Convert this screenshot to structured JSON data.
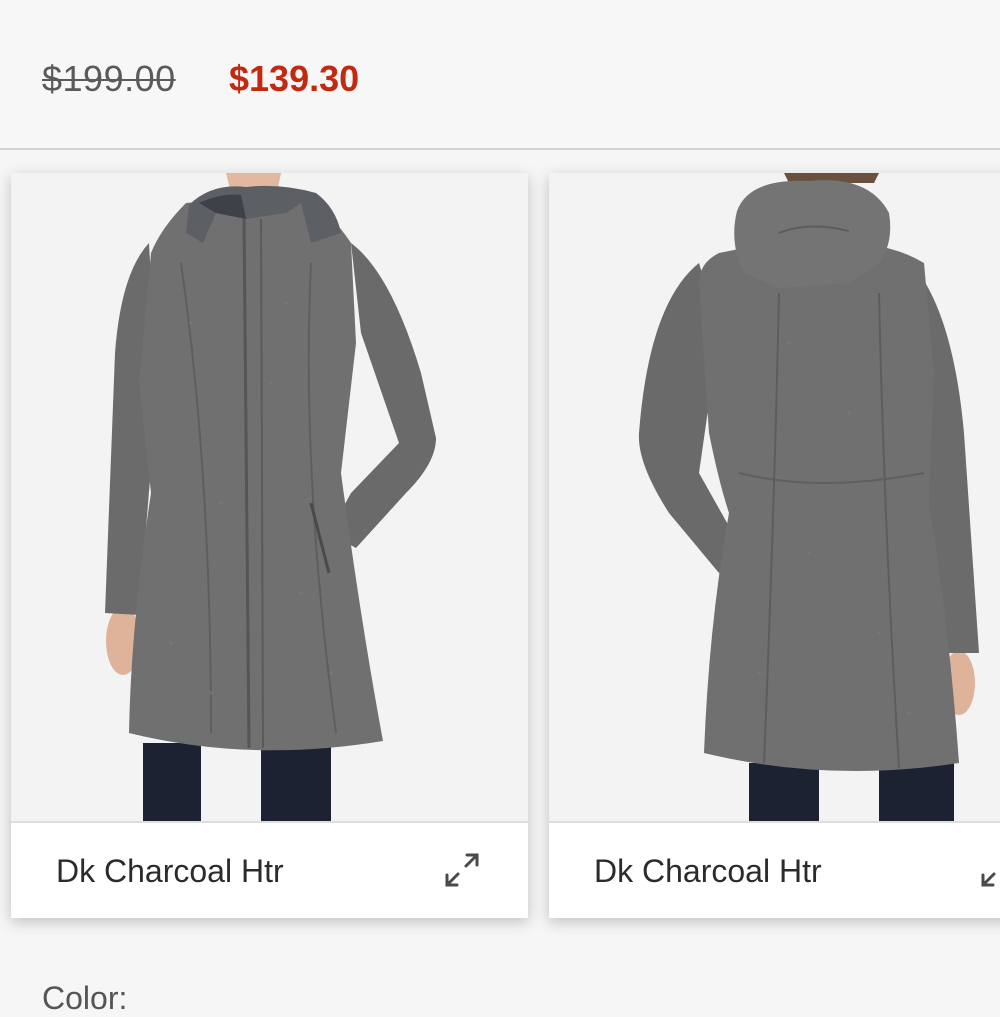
{
  "pricing": {
    "original_price": "$199.00",
    "sale_price": "$139.30",
    "sale_color": "#c12a10"
  },
  "gallery": {
    "items": [
      {
        "view": "front",
        "color_name": "Dk Charcoal Htr",
        "action_icon": "expand-icon"
      },
      {
        "view": "back",
        "color_name": "Dk Charcoal Htr",
        "action_icon": "expand-icon"
      }
    ]
  },
  "color_section": {
    "label": "Color:"
  }
}
